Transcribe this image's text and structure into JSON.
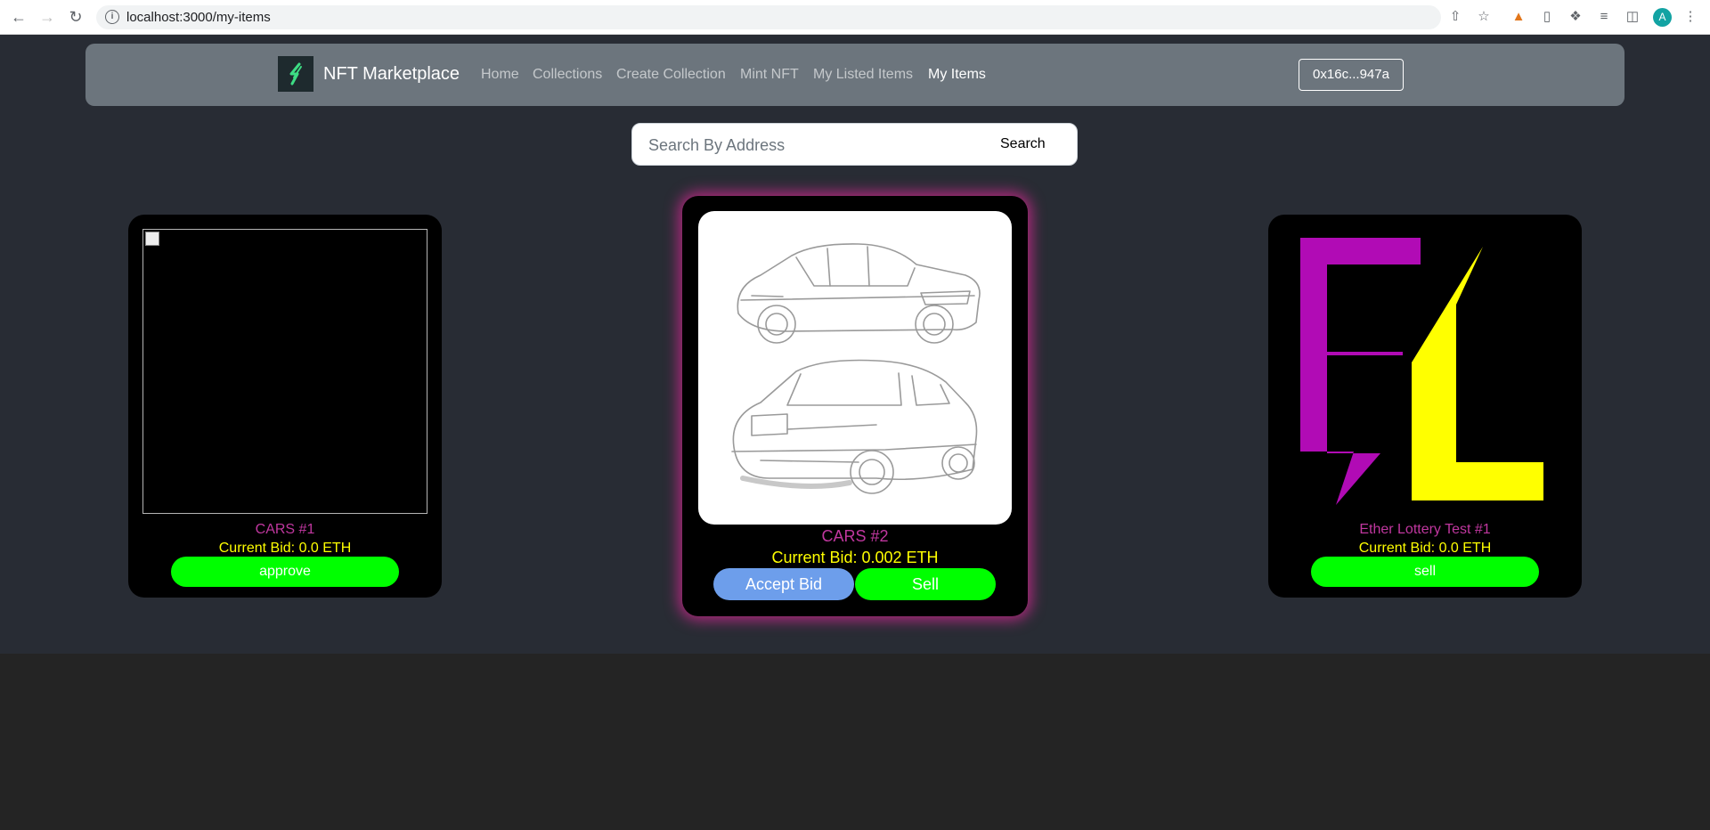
{
  "browser": {
    "url": "localhost:3000/my-items",
    "icons": [
      "back-icon",
      "forward-icon",
      "reload-icon",
      "info-icon",
      "share-icon",
      "star-icon",
      "metamask-fox-icon",
      "phone-icon",
      "extensions-puzzle-icon",
      "reading-list-icon",
      "side-panel-icon",
      "menu-dots-icon"
    ],
    "profile_initial": "A"
  },
  "navbar": {
    "brand": "NFT Marketplace",
    "links": [
      {
        "label": "Home",
        "active": false
      },
      {
        "label": "Collections",
        "active": false
      },
      {
        "label": "Create Collection",
        "active": false
      },
      {
        "label": "Mint NFT",
        "active": false
      },
      {
        "label": "My Listed Items",
        "active": false
      },
      {
        "label": "My Items",
        "active": true
      }
    ],
    "wallet": "0x16c...947a"
  },
  "search": {
    "placeholder": "Search By Address",
    "button": "Search"
  },
  "cards": [
    {
      "title": "CARS #1",
      "bid": "Current Bid: 0.0 ETH",
      "buttons": [
        "approve"
      ],
      "image": "broken"
    },
    {
      "title": "CARS #2",
      "bid": "Current Bid: 0.002 ETH",
      "buttons": [
        "Accept Bid",
        "Sell"
      ],
      "image": "car-sketch"
    },
    {
      "title": "Ether Lottery Test #1",
      "bid": "Current Bid: 0.0 ETH",
      "buttons": [
        "sell"
      ],
      "image": "el-logo"
    }
  ],
  "colors": {
    "page_bg": "#282c34",
    "navbar_bg": "#6c757d",
    "title_pink": "#c0379f",
    "bid_yellow": "#ffff00",
    "green_button": "#00ff00",
    "blue_button": "#6d9eeb",
    "glow": "#b2287f"
  }
}
